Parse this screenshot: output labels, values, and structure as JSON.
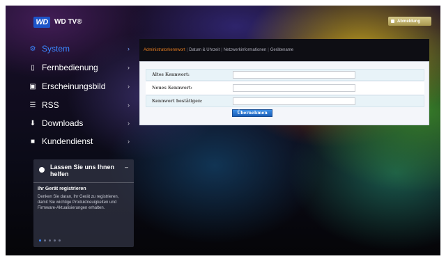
{
  "header": {
    "logo_text": "WD",
    "brand": "WD TV®",
    "logout_label": "Abmeldung"
  },
  "sidebar": {
    "items": [
      {
        "label": "System",
        "icon": "gear-icon",
        "glyph": "⚙",
        "active": true
      },
      {
        "label": "Fernbedienung",
        "icon": "remote-icon",
        "glyph": "▯",
        "active": false
      },
      {
        "label": "Erscheinungsbild",
        "icon": "picture-icon",
        "glyph": "▣",
        "active": false
      },
      {
        "label": "RSS",
        "icon": "rss-icon",
        "glyph": "☰",
        "active": false
      },
      {
        "label": "Downloads",
        "icon": "download-icon",
        "glyph": "⬇",
        "active": false
      },
      {
        "label": "Kundendienst",
        "icon": "support-icon",
        "glyph": "■",
        "active": false
      }
    ],
    "chevron": "›"
  },
  "help_panel": {
    "title": "Lassen Sie uns Ihnen helfen",
    "collapse_glyph": "–",
    "subtitle": "Ihr Gerät registrieren",
    "body": "Denken Sie daran, Ihr Gerät zu registrieren, damit Sie wichtige Produktneuigkeiten und Firmware-Aktualisierungen erhalten."
  },
  "tabs": [
    {
      "label": "Administratorkennwort",
      "active": true
    },
    {
      "label": "Datum & Uhrzeit",
      "active": false
    },
    {
      "label": "Netzwerkinformationen",
      "active": false
    },
    {
      "label": "Gerätename",
      "active": false
    }
  ],
  "form": {
    "fields": [
      {
        "label": "Altes Kennwort:",
        "value": "",
        "placeholder": ""
      },
      {
        "label": "Neues Kennwort:",
        "value": "",
        "placeholder": ""
      },
      {
        "label": "Kennwort bestätigen:",
        "value": "",
        "placeholder": ""
      }
    ],
    "apply_label": "Übernehmen"
  },
  "colors": {
    "accent_blue": "#3b86ff",
    "active_tab_orange": "#e87e20",
    "logout_gold": "#c8b86a"
  }
}
